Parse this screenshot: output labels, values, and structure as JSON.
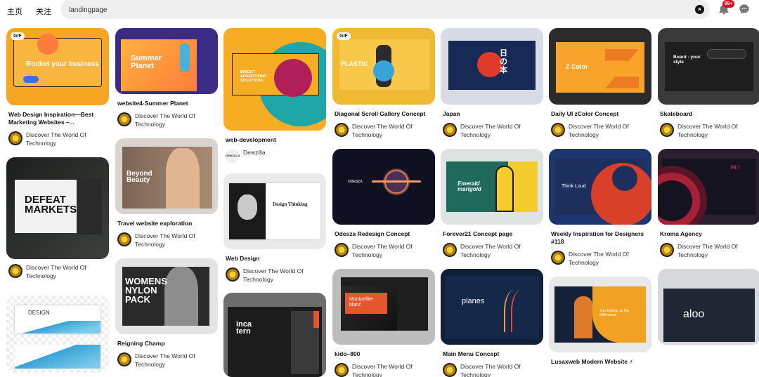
{
  "nav": {
    "home": "主页",
    "follow": "关注"
  },
  "search": {
    "value": "landingpage"
  },
  "notifications": {
    "badge": "99+"
  },
  "pins": [
    {
      "title": "Web Design Inspiration—Best Marketing Websites –...",
      "author": "Discover The World Of Technology",
      "gif": "GIF",
      "art": "Rocket your business"
    },
    {
      "title": "",
      "author": "Discover The World Of Technology",
      "art": "DEFEAT MARKETS"
    },
    {
      "title": "",
      "author": "",
      "art": "DESIGN"
    },
    {
      "title": "website4-Summer Planet",
      "author": "Discover The World Of Technology",
      "art": "Summer Planet"
    },
    {
      "title": "Travel website exploration",
      "author": "Discover The World Of Technology",
      "art": "Beyond Beauty"
    },
    {
      "title": "Reigning Champ",
      "author": "Discover The World Of Technology",
      "art": "WOMENS NYLON PACK"
    },
    {
      "title": "web-development",
      "author": "Dewzilla",
      "art": "BRIGHT ADVERTISING SOLUTIONS"
    },
    {
      "title": "Web Design",
      "author": "Discover The World Of Technology",
      "art": "Design Thinking"
    },
    {
      "title": "",
      "author": "",
      "art": "inca tern"
    },
    {
      "title": "Diagonal Scroll Gallery Concept",
      "author": "Discover The World Of Technology",
      "gif": "GIF",
      "art": "PLASTIC"
    },
    {
      "title": "Odesza Redesign Concept",
      "author": "Discover The World Of Technology",
      "art": "ODESZA"
    },
    {
      "title": "kido–800",
      "author": "Discover The World Of Technology",
      "art": "Montpellier blanc"
    },
    {
      "title": "Japan",
      "author": "Discover The World Of Technology",
      "art": "日の本"
    },
    {
      "title": "Forever21 Concept page",
      "author": "Discover The World Of Technology",
      "art": "Emerald marigold"
    },
    {
      "title": "Main Menu Concept",
      "author": "Discover The World Of Technology",
      "art": "planes"
    },
    {
      "title": "Daily UI zColor Concept",
      "author": "Discover The World Of Technology",
      "art": "Z Color"
    },
    {
      "title": "Weekly Inspiration for Designers #118",
      "author": "Discover The World Of Technology",
      "art": "Think Loud"
    },
    {
      "title": "Lusaxweb Modern Website ⚡",
      "author": "",
      "art": "You belong to the difference"
    },
    {
      "title": "Skateboard",
      "author": "Discover The World Of Technology",
      "art": "Board - your style"
    },
    {
      "title": "Kroma Agency",
      "author": "Discover The World Of Technology",
      "art": "Hi !"
    },
    {
      "title": "",
      "author": "",
      "art": "aloo"
    }
  ]
}
